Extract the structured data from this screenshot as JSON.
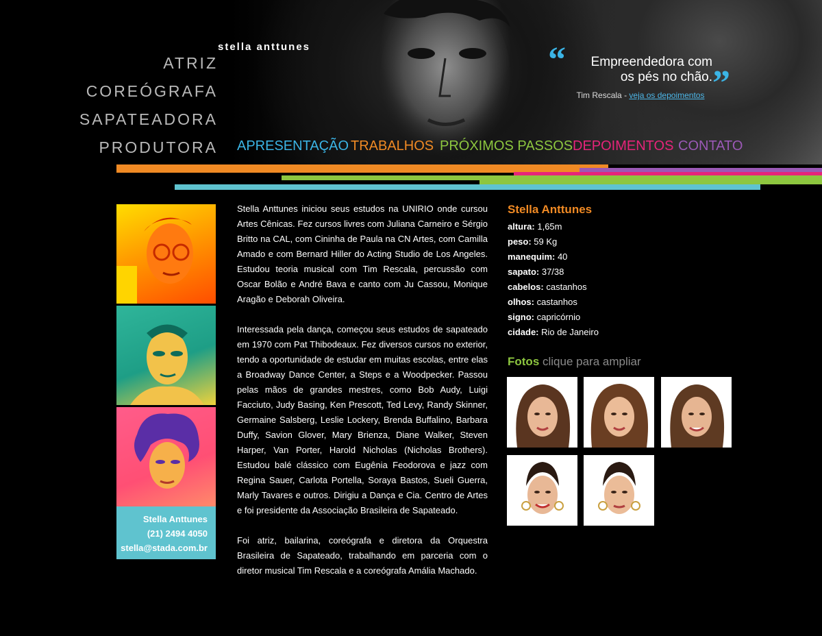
{
  "header": {
    "brand": "stella anttunes",
    "roles": [
      "ATRIZ",
      "COREÓGRAFA",
      "SAPATEADORA",
      "PRODUTORA"
    ],
    "quote": {
      "open_mark": "“",
      "close_mark": "”",
      "line1": "Empreendedora com",
      "line2": "os pés no chão.",
      "author": "Tim Rescala - ",
      "link": "veja os depoimentos"
    }
  },
  "nav": {
    "items": [
      {
        "label": "APRESENTAÇÃO",
        "color": "#3bb4e5"
      },
      {
        "label": "TRABALHOS",
        "color": "#f08a24"
      },
      {
        "label": "PRÓXIMOS PASSOS",
        "color": "#8dc63f"
      },
      {
        "label": "DEPOIMENTOS",
        "color": "#e6247a"
      },
      {
        "label": "CONTATO",
        "color": "#9b59b6"
      }
    ]
  },
  "contact": {
    "name": "Stella Anttunes",
    "phone": "(21) 2494 4050",
    "email": "stella@stada.com.br"
  },
  "bio": {
    "paragraphs": [
      "Stella Anttunes iniciou seus estudos na UNIRIO onde cursou Artes Cênicas. Fez cursos livres com Juliana Carneiro e Sérgio Britto na CAL, com Cininha de Paula na CN Artes, com Camilla Amado e com Bernard Hiller do Acting Studio de Los Angeles. Estudou teoria musical com Tim Rescala, percussão com Oscar Bolão e André Bava e canto com Ju Cassou, Monique Aragão e Deborah Oliveira.",
      "Interessada pela dança, começou seus estudos de sapateado em 1970 com Pat Thibodeaux.  Fez diversos cursos no exterior, tendo a oportunidade de estudar em muitas escolas, entre elas a Broadway Dance Center, a  Steps e a Woodpecker. Passou pelas mãos de grandes mestres, como Bob Audy, Luigi Facciuto, Judy Basing, Ken Prescott, Ted Levy, Randy Skinner, Germaine Salsberg, Leslie Lockery, Brenda Buffalino, Barbara Duffy, Savion Glover, Mary Brienza, Diane Walker, Steven Harper, Van Porter, Harold Nicholas (Nicholas Brothers). Estudou balé clássico com Eugênia Feodorova e jazz com Regina Sauer, Carlota Portella, Soraya Bastos, Sueli Guerra, Marly Tavares e outros. Dirigiu a Dança e Cia. Centro de Artes e foi presidente da Associação Brasileira de Sapateado.",
      "Foi atriz, bailarina, coreógrafa e diretora da Orquestra Brasileira de Sapateado, trabalhando em parceria com o diretor musical Tim Rescala e a coreógrafa Amália Machado."
    ]
  },
  "info": {
    "title": "Stella Anttunes",
    "rows": [
      {
        "key": "altura:",
        "value": " 1,65m"
      },
      {
        "key": "peso:",
        "value": " 59 Kg"
      },
      {
        "key": "manequim:",
        "value": " 40"
      },
      {
        "key": "sapato:",
        "value": " 37/38"
      },
      {
        "key": "cabelos:",
        "value": " castanhos"
      },
      {
        "key": "olhos:",
        "value": " castanhos"
      },
      {
        "key": "signo:",
        "value": " capricórnio"
      },
      {
        "key": "cidade:",
        "value": " Rio de Janeiro"
      }
    ]
  },
  "fotos": {
    "label": "Fotos",
    "hint": " clique para ampliar",
    "count": 5
  },
  "colors": {
    "orange": "#f08a24",
    "green": "#8dc63f",
    "cyan": "#5fc3cf",
    "magenta": "#e6247a",
    "purple": "#9b59b6",
    "blue": "#3bb4e5"
  }
}
